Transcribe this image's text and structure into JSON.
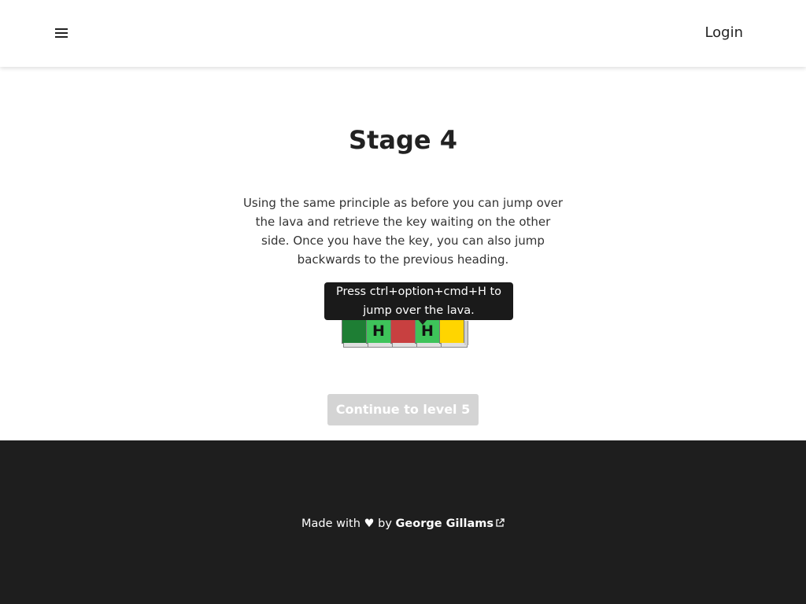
{
  "header": {
    "menu_icon": "hamburger-menu-icon",
    "login_label": "Login"
  },
  "main": {
    "title": "Stage 4",
    "instructions": "Using the same principle as before you can jump over the lava and retrieve the key waiting on the other side. Once you have the key, you can also jump backwards to the previous heading.",
    "tooltip": "Press ctrl+option+cmd+H to jump over the lava.",
    "tiles": [
      {
        "label": "",
        "color": "#1e7e34",
        "type": "start"
      },
      {
        "label": "H",
        "color": "#3ec35a",
        "type": "heading"
      },
      {
        "label": "",
        "color": "#c84040",
        "type": "lava"
      },
      {
        "label": "H",
        "color": "#3ec35a",
        "type": "heading"
      },
      {
        "label": "",
        "color": "#ffd500",
        "type": "key"
      }
    ],
    "continue_label": "Continue to level 5"
  },
  "footer": {
    "made_with": "Made with",
    "heart": "♥",
    "by": "by",
    "author": "George Gillams",
    "external_link_icon": "external-link-icon"
  },
  "colors": {
    "footer_bg": "#1e1e1e",
    "tooltip_bg": "#1a1a1a",
    "disabled_button": "#d4d4d4"
  }
}
